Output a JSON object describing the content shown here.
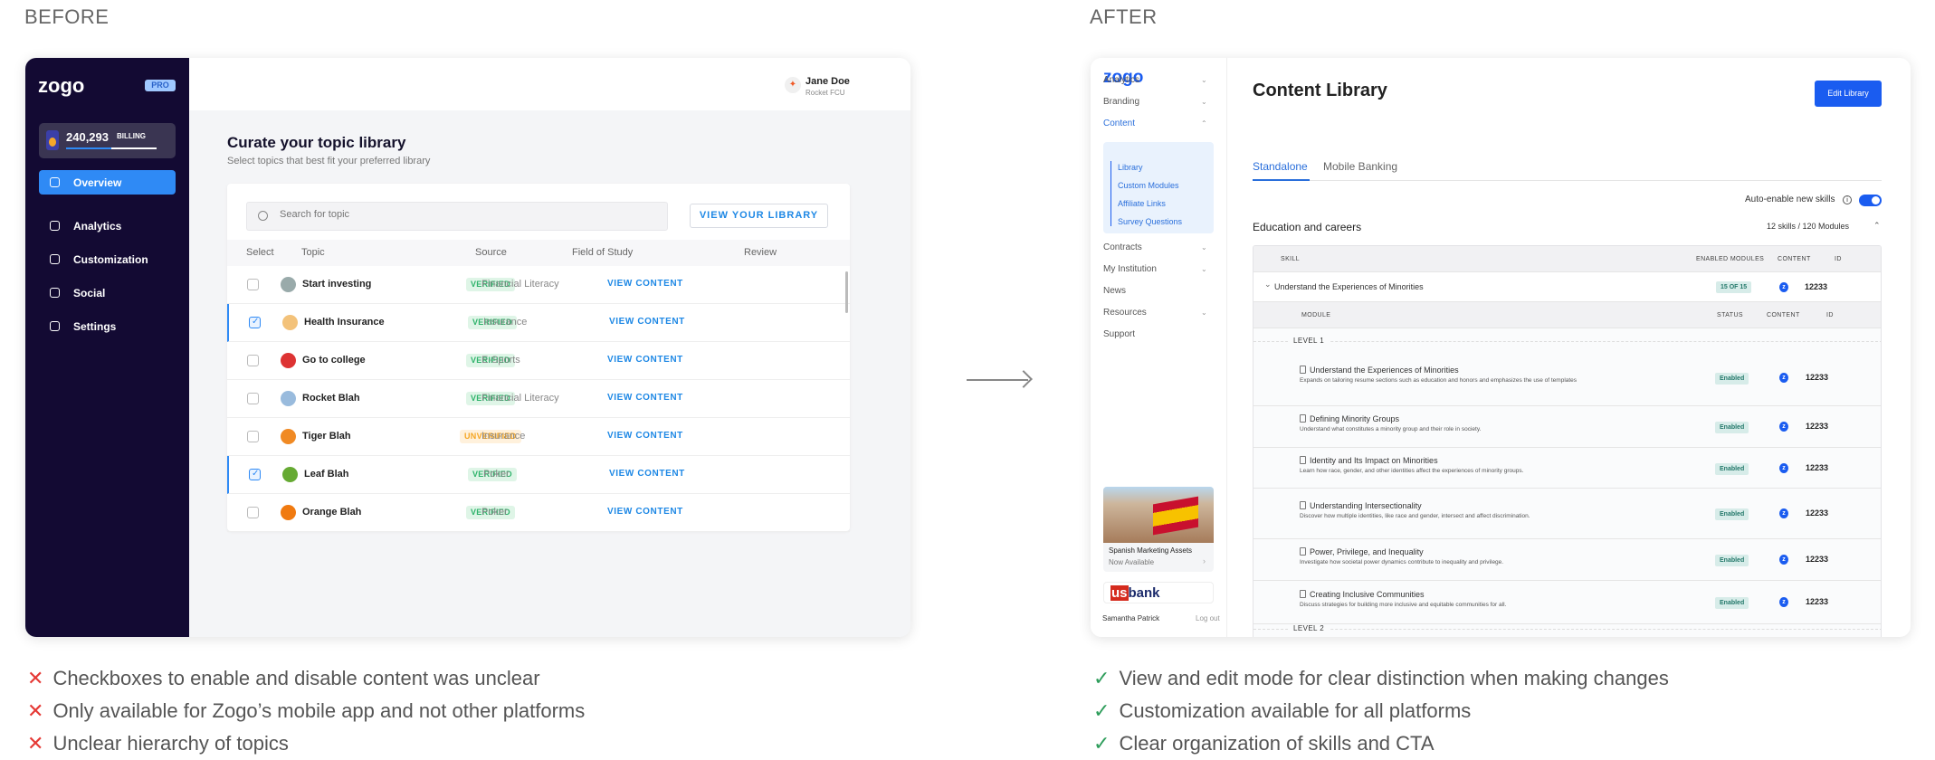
{
  "labels": {
    "before": "BEFORE",
    "after": "AFTER"
  },
  "before": {
    "logo": "zogo",
    "pro_badge": "PRO",
    "billing": {
      "points": "240,293",
      "label": "BILLING",
      "progress": 0.5
    },
    "nav": [
      {
        "label": "Overview",
        "icon": "home-icon",
        "active": true
      },
      {
        "label": "Analytics",
        "icon": "pie-chart-icon"
      },
      {
        "label": "Customization",
        "icon": "grid-icon"
      },
      {
        "label": "Social",
        "icon": "users-icon"
      },
      {
        "label": "Settings",
        "icon": "gear-icon"
      }
    ],
    "user": {
      "name": "Jane Doe",
      "org": "Rocket FCU"
    },
    "title": "Curate your topic library",
    "subtitle": "Select topics that best fit your preferred library",
    "search_placeholder": "Search for topic",
    "view_library": "VIEW YOUR LIBRARY",
    "columns": [
      "Select",
      "Topic",
      "Source",
      "Field of Study",
      "Review"
    ],
    "rows": [
      {
        "selected": false,
        "icon": "wolf-icon",
        "topic": "Start investing",
        "source": "VERIFIED",
        "field": "Financial Literacy",
        "review": "VIEW CONTENT"
      },
      {
        "selected": true,
        "icon": "health-worker-icon",
        "topic": "Health Insurance",
        "source": "VERIFIED",
        "field": "Insurance",
        "review": "VIEW CONTENT"
      },
      {
        "selected": false,
        "icon": "school-icon",
        "topic": "Go to college",
        "source": "VERIFIED",
        "field": "E-Sports",
        "review": "VIEW CONTENT"
      },
      {
        "selected": false,
        "icon": "rocket-icon",
        "topic": "Rocket Blah",
        "source": "VERIFIED",
        "field": "Financial Literacy",
        "review": "VIEW CONTENT"
      },
      {
        "selected": false,
        "icon": "tiger-icon",
        "topic": "Tiger Blah",
        "source": "UNVERIFIED",
        "field": "Insurance",
        "review": "VIEW CONTENT"
      },
      {
        "selected": true,
        "icon": "leaf-icon",
        "topic": "Leaf Blah",
        "source": "VERIFIED",
        "field": "Poker",
        "review": "VIEW CONTENT"
      },
      {
        "selected": false,
        "icon": "orange-icon",
        "topic": "Orange Blah",
        "source": "VERIFIED",
        "field": "Poker",
        "review": "VIEW CONTENT"
      }
    ]
  },
  "after": {
    "logo": "zogo",
    "nav": [
      {
        "label": "Analytics",
        "chevron": "down"
      },
      {
        "label": "Branding",
        "chevron": "down"
      },
      {
        "label": "Content",
        "chevron": "up",
        "active": true
      },
      {
        "label": "Contracts",
        "chevron": "down"
      },
      {
        "label": "My Institution",
        "chevron": "down"
      },
      {
        "label": "News"
      },
      {
        "label": "Resources",
        "chevron": "down"
      },
      {
        "label": "Support"
      }
    ],
    "content_sub": [
      "Library",
      "Custom Modules",
      "Affiliate Links",
      "Survey Questions"
    ],
    "promo": {
      "title": "Spanish Marketing Assets",
      "subtitle": "Now Available"
    },
    "bank_logo": "usbank",
    "user": "Samantha Patrick",
    "logout": "Log out",
    "title": "Content Library",
    "edit_button": "Edit Library",
    "tabs": [
      "Standalone",
      "Mobile Banking"
    ],
    "auto_enable": "Auto-enable new skills",
    "auto_enable_on": true,
    "section": {
      "title": "Education and careers",
      "count": "12 skills / 120 Modules"
    },
    "skill_columns": [
      "SKILL",
      "ENABLED MODULES",
      "CONTENT",
      "ID"
    ],
    "skill": {
      "name": "Understand the Experiences of Minorities",
      "enabled": "15 OF 15",
      "id": "12233"
    },
    "module_columns": [
      "MODULE",
      "STATUS",
      "CONTENT",
      "ID"
    ],
    "levels": [
      "LEVEL 1",
      "LEVEL 2"
    ],
    "modules": [
      {
        "title": "Understand the Experiences of Minorities",
        "desc": "Expands on tailoring resume sections such as education and honors and emphasizes the use of templates",
        "status": "Enabled",
        "id": "12233"
      },
      {
        "title": "Defining Minority Groups",
        "desc": "Understand what constitutes a minority group and their role in society.",
        "status": "Enabled",
        "id": "12233"
      },
      {
        "title": "Identity and Its Impact on Minorities",
        "desc": "Learn how race, gender, and other identities affect the experiences of minority groups.",
        "status": "Enabled",
        "id": "12233"
      },
      {
        "title": "Understanding Intersectionality",
        "desc": "Discover how multiple identities, like race and gender, intersect and affect discrimination.",
        "status": "Enabled",
        "id": "12233"
      },
      {
        "title": "Power, Privilege, and Inequality",
        "desc": "Investigate how societal power dynamics contribute to inequality and privilege.",
        "status": "Enabled",
        "id": "12233"
      },
      {
        "title": "Creating Inclusive Communities",
        "desc": "Discuss strategies for building more inclusive and equitable communities for all.",
        "status": "Enabled",
        "id": "12233"
      }
    ]
  },
  "cons": [
    "Checkboxes to enable and disable content was unclear",
    "Only available for Zogo’s mobile app and not other platforms",
    "Unclear hierarchy of topics"
  ],
  "pros": [
    "View and edit mode for clear distinction when making changes",
    "Customization available for all platforms",
    "Clear organization of skills and CTA"
  ],
  "colors": {
    "sidebar_dark": "#130a33",
    "accent_before": "#2f8af5",
    "accent_after": "#1a5cf0",
    "verified": "#2fb36b",
    "unverified": "#f5a623",
    "cross": "#e53935",
    "check": "#2e9d5b"
  }
}
